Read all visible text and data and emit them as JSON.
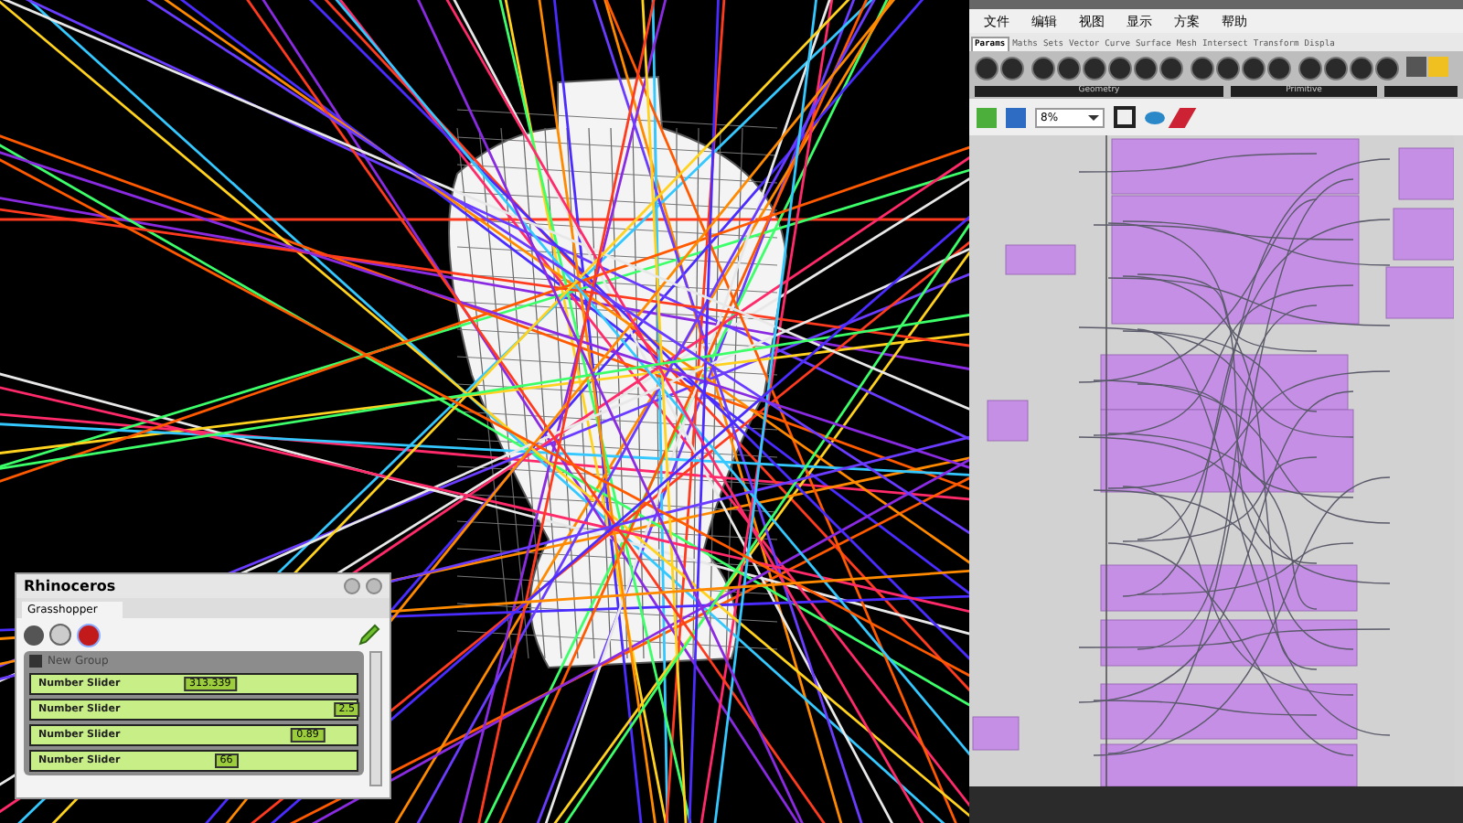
{
  "grasshopper": {
    "menu": [
      "文件",
      "编辑",
      "视图",
      "显示",
      "方案",
      "帮助"
    ],
    "tabs": [
      {
        "label": "Params",
        "selected": true
      },
      {
        "label": "Maths",
        "selected": false
      },
      {
        "label": "Sets",
        "selected": false
      },
      {
        "label": "Vector",
        "selected": false
      },
      {
        "label": "Curve",
        "selected": false
      },
      {
        "label": "Surface",
        "selected": false
      },
      {
        "label": "Mesh",
        "selected": false
      },
      {
        "label": "Intersect",
        "selected": false
      },
      {
        "label": "Transform",
        "selected": false
      },
      {
        "label": "Displa",
        "selected": false
      }
    ],
    "panel_groups": [
      "Geometry",
      "Primitive"
    ],
    "zoom": "8%"
  },
  "rhino_panel": {
    "title": "Rhinoceros",
    "tab": "Grasshopper",
    "group": {
      "label": "New Group",
      "checked": true
    },
    "sliders": [
      {
        "label": "Number Slider",
        "value": "313.339",
        "level": 0.55
      },
      {
        "label": "Number Slider",
        "value": "2.5",
        "level": 0.97
      },
      {
        "label": "Number Slider",
        "value": "0.89",
        "level": 0.85
      },
      {
        "label": "Number Slider",
        "value": "66",
        "level": 0.6
      }
    ]
  }
}
